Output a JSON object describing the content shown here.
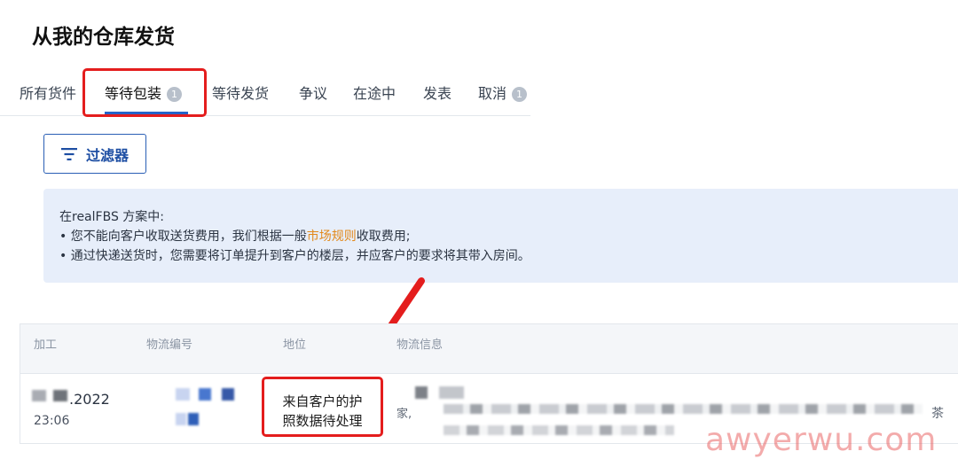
{
  "page": {
    "title": "从我的仓库发货"
  },
  "tabs": [
    {
      "label": "所有货件"
    },
    {
      "label": "等待包装",
      "badge": "1"
    },
    {
      "label": "等待发货"
    },
    {
      "label": "争议"
    },
    {
      "label": "在途中"
    },
    {
      "label": "发表"
    },
    {
      "label": "取消",
      "badge": "1"
    }
  ],
  "filter": {
    "label": "过滤器",
    "icon": "filter-icon"
  },
  "notice": {
    "heading": "在realFBS 方案中:",
    "line1_pre": "• 您不能向客户收取送货费用，我们根据一般",
    "line1_link": "市场规则",
    "line1_post": "收取费用;",
    "line2": "• 通过快递送货时，您需要将订单提升到客户的楼层，并应客户的要求将其带入房间。",
    "link_color": "#e2891b"
  },
  "table": {
    "headers": [
      "加工",
      "物流编号",
      "地位",
      "物流信息"
    ],
    "row": {
      "date": ".2022",
      "time": "23:06",
      "status_line1": "来自客户的护",
      "status_line2": "照数据待处理",
      "info_prefix": "家,",
      "info_suffix": "茶"
    }
  },
  "watermark": "awyerwu.com",
  "colors": {
    "accent": "#2563c8",
    "highlight": "#e41d1d",
    "notice_bg": "#e7eefa"
  }
}
